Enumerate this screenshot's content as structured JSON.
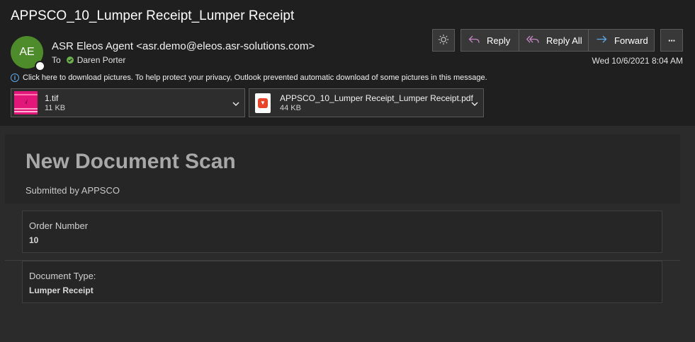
{
  "subject": "APPSCO_10_Lumper Receipt_Lumper Receipt",
  "sender": {
    "initials": "AE",
    "display": "ASR Eleos Agent <asr.demo@eleos.asr-solutions.com>",
    "avatar_color": "#4e8b2a"
  },
  "recipients": {
    "label": "To",
    "name": "Daren Porter"
  },
  "toolbar": {
    "theme_icon": "sun-icon",
    "reply": "Reply",
    "reply_all": "Reply All",
    "forward": "Forward",
    "more": "···"
  },
  "date": "Wed 10/6/2021 8:04 AM",
  "info_bar": "Click here to download pictures. To help protect your privacy, Outlook prevented automatic download of some pictures in this message.",
  "attachments": [
    {
      "name": "1.tif",
      "size": "11 KB",
      "icon": "tif-thumbnail"
    },
    {
      "name": "APPSCO_10_Lumper Receipt_Lumper Receipt.pdf",
      "size": "44 KB",
      "icon": "pdf-icon"
    }
  ],
  "message": {
    "title": "New Document Scan",
    "subtitle": "Submitted by APPSCO",
    "fields": [
      {
        "label": "Order Number",
        "value": "10"
      },
      {
        "label": "Document Type:",
        "value": "Lumper Receipt"
      }
    ]
  },
  "colors": {
    "accent": "#5ea9e8",
    "reply_icon": "#c586c0",
    "forward_icon": "#5ea9e8",
    "presence": "#6ab04c"
  }
}
